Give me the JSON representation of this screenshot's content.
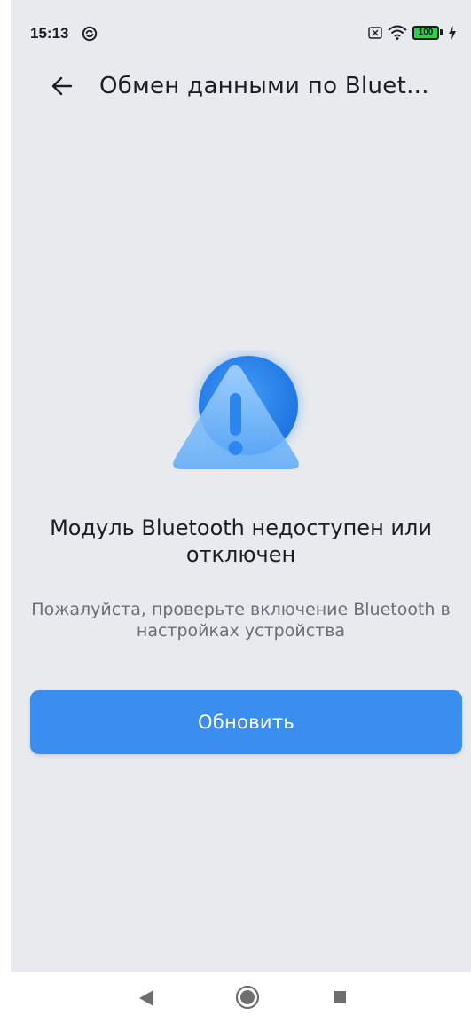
{
  "status_bar": {
    "time": "15:13",
    "battery": "100",
    "icons": [
      "sync-icon",
      "no-sim-icon",
      "wifi-icon",
      "battery-icon",
      "charging-icon"
    ]
  },
  "app_bar": {
    "title": "Обмен данными по Bluet...",
    "back_icon": "arrow-left-icon"
  },
  "content": {
    "illustration": "warning-triangle-icon",
    "title": "Модуль Bluetooth недоступен или отключен",
    "hint": "Пожалуйста, проверьте включение Bluetooth в настройках устройства",
    "refresh_label": "Обновить"
  },
  "nav_bar": {
    "icons": [
      "nav-back-icon",
      "nav-home-icon",
      "nav-recents-icon"
    ]
  },
  "colors": {
    "background": "#e8eaee",
    "accent": "#3a8ef0",
    "text": "#1b1d24",
    "secondary_text": "#6b6e78"
  }
}
